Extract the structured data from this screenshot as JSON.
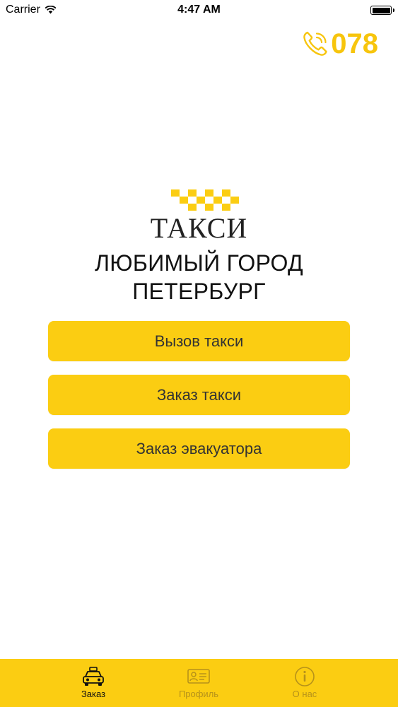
{
  "status_bar": {
    "carrier": "Carrier",
    "time": "4:47 AM"
  },
  "header": {
    "phone_number": "078",
    "phone_icon": "phone-icon"
  },
  "logo": {
    "word": "ТАКСИ",
    "tagline_line1": "ЛЮБИМЫЙ ГОРОД",
    "tagline_line2": "ПЕТЕРБУРГ"
  },
  "buttons": {
    "call_taxi": "Вызов такси",
    "order_taxi": "Заказ такси",
    "order_tow": "Заказ эвакуатора"
  },
  "tabbar": {
    "items": [
      {
        "label": "Заказ",
        "icon": "taxi-car-icon",
        "active": true
      },
      {
        "label": "Профиль",
        "icon": "id-card-icon",
        "active": false
      },
      {
        "label": "О нас",
        "icon": "info-icon",
        "active": false
      }
    ]
  },
  "colors": {
    "accent": "#fbcd12",
    "phone": "#f7c50d",
    "inactive_tab": "#b6921a"
  }
}
